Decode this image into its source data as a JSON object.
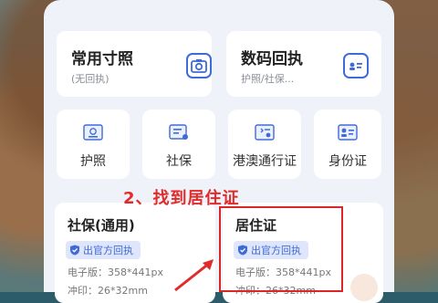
{
  "colors": {
    "accent": "#3f6bd7",
    "annotation": "#e22a2a",
    "panel": "#f0f2f9",
    "card": "#ffffff"
  },
  "cards": {
    "common": {
      "title": "常用寸照",
      "subtitle": "(无回执)",
      "icon": "camera-icon"
    },
    "digital": {
      "title": "数码回执",
      "subtitle": "护照/社保...",
      "icon": "id-card-icon"
    }
  },
  "categories": [
    {
      "label": "护照",
      "icon": "passport-icon"
    },
    {
      "label": "社保",
      "icon": "social-security-icon"
    },
    {
      "label": "港澳通行证",
      "icon": "travel-permit-icon"
    },
    {
      "label": "身份证",
      "icon": "id-card-icon"
    }
  ],
  "annotation": "2、找到居住证",
  "docs": [
    {
      "title": "社保(通用)",
      "badge": "出官方回执",
      "spec1": "电子版：358*441px",
      "spec2": "冲印：26*32mm"
    },
    {
      "title": "居住证",
      "badge": "出官方回执",
      "spec1": "电子版：358*441px",
      "spec2": "冲印：26*32mm"
    }
  ]
}
